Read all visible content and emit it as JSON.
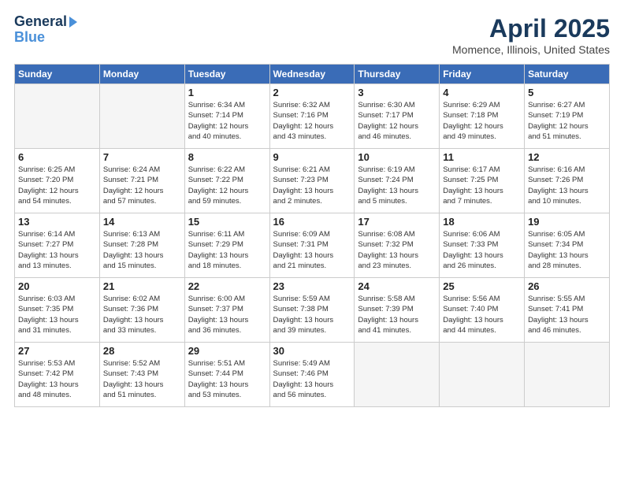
{
  "logo": {
    "line1": "General",
    "line2": "Blue"
  },
  "title": "April 2025",
  "location": "Momence, Illinois, United States",
  "header_days": [
    "Sunday",
    "Monday",
    "Tuesday",
    "Wednesday",
    "Thursday",
    "Friday",
    "Saturday"
  ],
  "weeks": [
    [
      {
        "day": "",
        "info": ""
      },
      {
        "day": "",
        "info": ""
      },
      {
        "day": "1",
        "info": "Sunrise: 6:34 AM\nSunset: 7:14 PM\nDaylight: 12 hours\nand 40 minutes."
      },
      {
        "day": "2",
        "info": "Sunrise: 6:32 AM\nSunset: 7:16 PM\nDaylight: 12 hours\nand 43 minutes."
      },
      {
        "day": "3",
        "info": "Sunrise: 6:30 AM\nSunset: 7:17 PM\nDaylight: 12 hours\nand 46 minutes."
      },
      {
        "day": "4",
        "info": "Sunrise: 6:29 AM\nSunset: 7:18 PM\nDaylight: 12 hours\nand 49 minutes."
      },
      {
        "day": "5",
        "info": "Sunrise: 6:27 AM\nSunset: 7:19 PM\nDaylight: 12 hours\nand 51 minutes."
      }
    ],
    [
      {
        "day": "6",
        "info": "Sunrise: 6:25 AM\nSunset: 7:20 PM\nDaylight: 12 hours\nand 54 minutes."
      },
      {
        "day": "7",
        "info": "Sunrise: 6:24 AM\nSunset: 7:21 PM\nDaylight: 12 hours\nand 57 minutes."
      },
      {
        "day": "8",
        "info": "Sunrise: 6:22 AM\nSunset: 7:22 PM\nDaylight: 12 hours\nand 59 minutes."
      },
      {
        "day": "9",
        "info": "Sunrise: 6:21 AM\nSunset: 7:23 PM\nDaylight: 13 hours\nand 2 minutes."
      },
      {
        "day": "10",
        "info": "Sunrise: 6:19 AM\nSunset: 7:24 PM\nDaylight: 13 hours\nand 5 minutes."
      },
      {
        "day": "11",
        "info": "Sunrise: 6:17 AM\nSunset: 7:25 PM\nDaylight: 13 hours\nand 7 minutes."
      },
      {
        "day": "12",
        "info": "Sunrise: 6:16 AM\nSunset: 7:26 PM\nDaylight: 13 hours\nand 10 minutes."
      }
    ],
    [
      {
        "day": "13",
        "info": "Sunrise: 6:14 AM\nSunset: 7:27 PM\nDaylight: 13 hours\nand 13 minutes."
      },
      {
        "day": "14",
        "info": "Sunrise: 6:13 AM\nSunset: 7:28 PM\nDaylight: 13 hours\nand 15 minutes."
      },
      {
        "day": "15",
        "info": "Sunrise: 6:11 AM\nSunset: 7:29 PM\nDaylight: 13 hours\nand 18 minutes."
      },
      {
        "day": "16",
        "info": "Sunrise: 6:09 AM\nSunset: 7:31 PM\nDaylight: 13 hours\nand 21 minutes."
      },
      {
        "day": "17",
        "info": "Sunrise: 6:08 AM\nSunset: 7:32 PM\nDaylight: 13 hours\nand 23 minutes."
      },
      {
        "day": "18",
        "info": "Sunrise: 6:06 AM\nSunset: 7:33 PM\nDaylight: 13 hours\nand 26 minutes."
      },
      {
        "day": "19",
        "info": "Sunrise: 6:05 AM\nSunset: 7:34 PM\nDaylight: 13 hours\nand 28 minutes."
      }
    ],
    [
      {
        "day": "20",
        "info": "Sunrise: 6:03 AM\nSunset: 7:35 PM\nDaylight: 13 hours\nand 31 minutes."
      },
      {
        "day": "21",
        "info": "Sunrise: 6:02 AM\nSunset: 7:36 PM\nDaylight: 13 hours\nand 33 minutes."
      },
      {
        "day": "22",
        "info": "Sunrise: 6:00 AM\nSunset: 7:37 PM\nDaylight: 13 hours\nand 36 minutes."
      },
      {
        "day": "23",
        "info": "Sunrise: 5:59 AM\nSunset: 7:38 PM\nDaylight: 13 hours\nand 39 minutes."
      },
      {
        "day": "24",
        "info": "Sunrise: 5:58 AM\nSunset: 7:39 PM\nDaylight: 13 hours\nand 41 minutes."
      },
      {
        "day": "25",
        "info": "Sunrise: 5:56 AM\nSunset: 7:40 PM\nDaylight: 13 hours\nand 44 minutes."
      },
      {
        "day": "26",
        "info": "Sunrise: 5:55 AM\nSunset: 7:41 PM\nDaylight: 13 hours\nand 46 minutes."
      }
    ],
    [
      {
        "day": "27",
        "info": "Sunrise: 5:53 AM\nSunset: 7:42 PM\nDaylight: 13 hours\nand 48 minutes."
      },
      {
        "day": "28",
        "info": "Sunrise: 5:52 AM\nSunset: 7:43 PM\nDaylight: 13 hours\nand 51 minutes."
      },
      {
        "day": "29",
        "info": "Sunrise: 5:51 AM\nSunset: 7:44 PM\nDaylight: 13 hours\nand 53 minutes."
      },
      {
        "day": "30",
        "info": "Sunrise: 5:49 AM\nSunset: 7:46 PM\nDaylight: 13 hours\nand 56 minutes."
      },
      {
        "day": "",
        "info": ""
      },
      {
        "day": "",
        "info": ""
      },
      {
        "day": "",
        "info": ""
      }
    ]
  ]
}
